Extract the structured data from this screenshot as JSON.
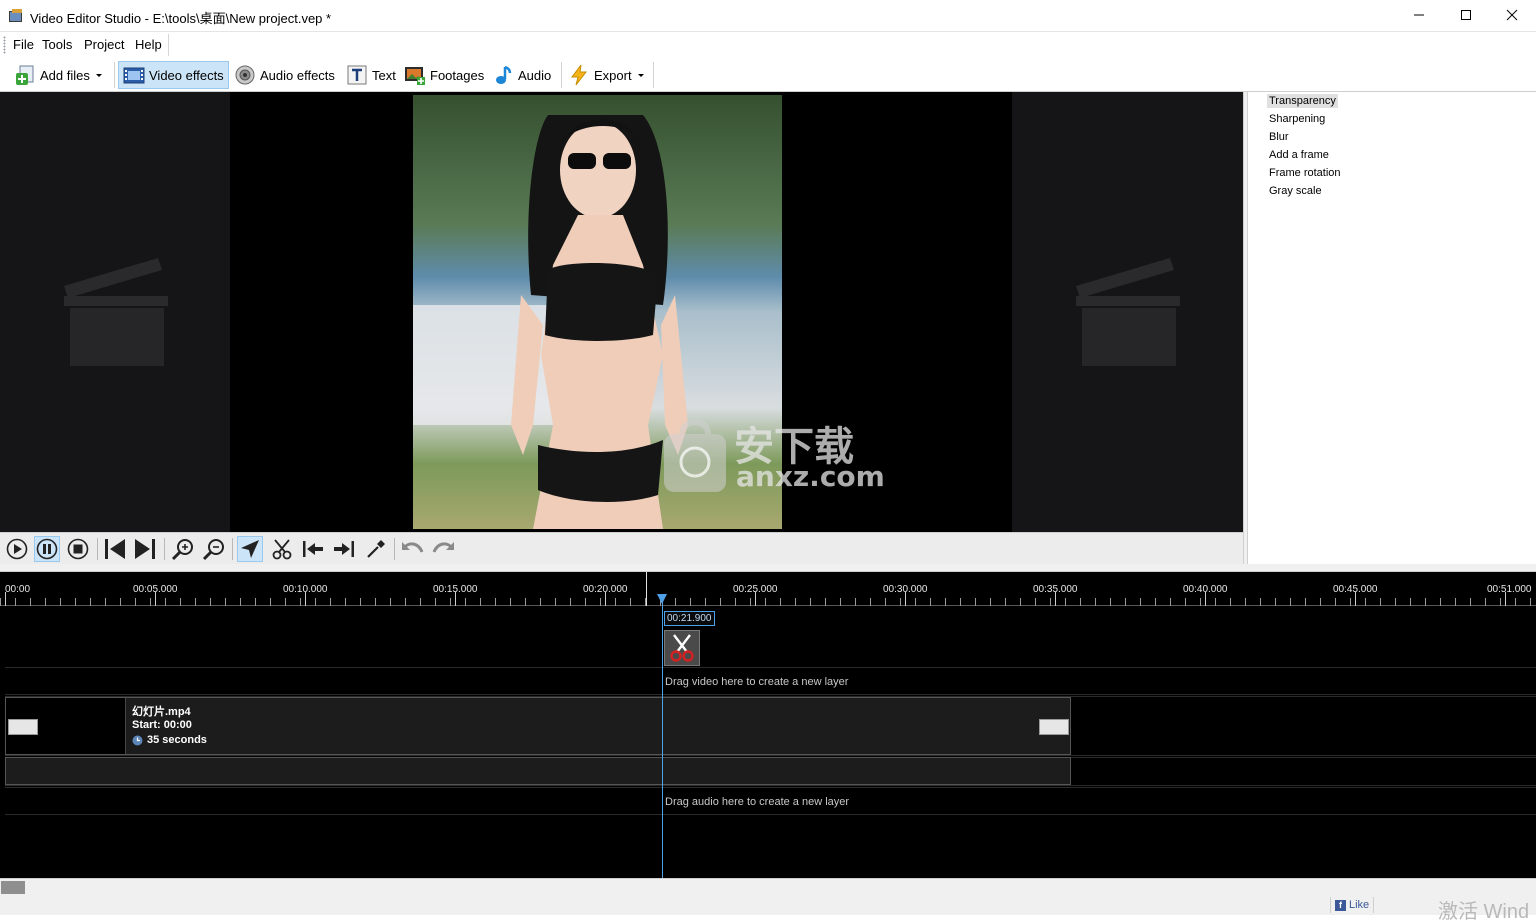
{
  "window": {
    "title": "Video Editor Studio - E:\\tools\\桌面\\New project.vep *"
  },
  "menu": {
    "items": [
      "File",
      "Tools",
      "Project",
      "Help"
    ]
  },
  "toolbar": {
    "add_files": "Add files",
    "video_effects": "Video effects",
    "audio_effects": "Audio effects",
    "text": "Text",
    "footages": "Footages",
    "audio": "Audio",
    "export": "Export"
  },
  "effects": {
    "items": [
      "Transparency",
      "Sharpening",
      "Blur",
      "Add a frame",
      "Frame rotation",
      "Gray scale"
    ],
    "selected": "Transparency"
  },
  "preview": {
    "watermark_cn": "安下载",
    "watermark_en": "anxz.com"
  },
  "timeline": {
    "ticks": [
      "00:00",
      "00:05.000",
      "00:10.000",
      "00:15.000",
      "00:20.000",
      "00:25.000",
      "00:30.000",
      "00:35.000",
      "00:40.000",
      "00:45.000",
      "00:51.000"
    ],
    "current_time": "00:21.900",
    "drop_video": "Drag video here to create a new layer",
    "drop_audio": "Drag audio here to create a new layer",
    "clip": {
      "name": "幻灯片.mp4",
      "start": "Start: 00:00",
      "duration": "35 seconds"
    }
  },
  "status": {
    "like": "Like",
    "activation": "激活 Wind"
  },
  "colors": {
    "accent": "#4ea0e8",
    "active_button": "#cce4f7",
    "timeline_bg": "#000000"
  }
}
